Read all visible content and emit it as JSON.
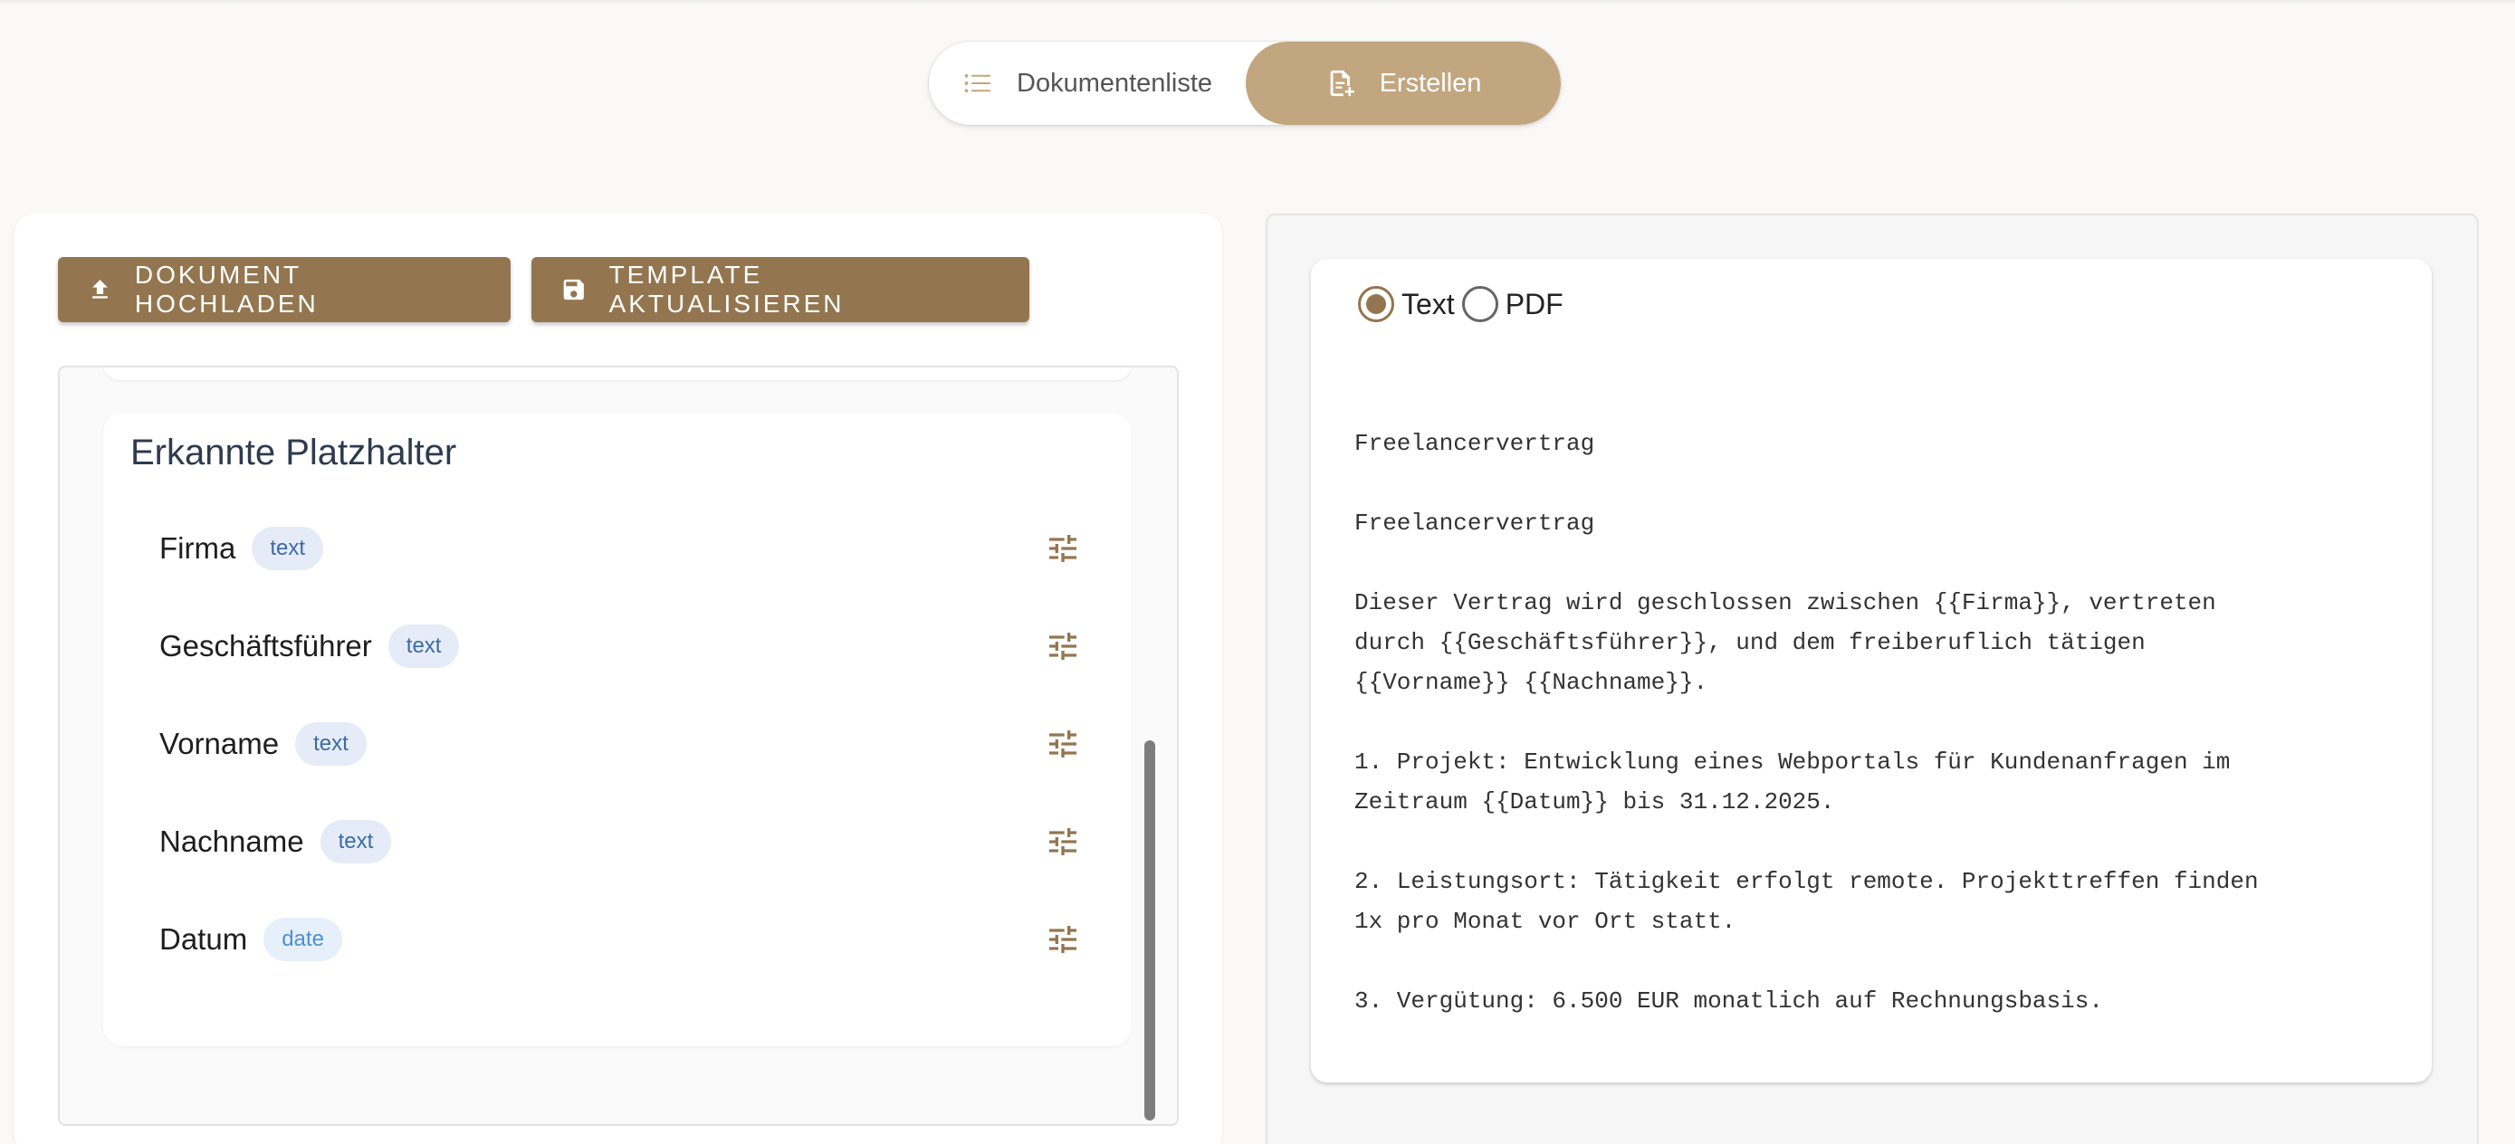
{
  "nav": {
    "tabs": [
      {
        "label": "Dokumentenliste",
        "icon": "list-icon",
        "active": false
      },
      {
        "label": "Erstellen",
        "icon": "file-add-icon",
        "active": true
      }
    ]
  },
  "toolbar": {
    "upload_label": "DOKUMENT HOCHLADEN",
    "update_label": "TEMPLATE AKTUALISIEREN"
  },
  "placeholders": {
    "title": "Erkannte Platzhalter",
    "items": [
      {
        "name": "Firma",
        "type": "text"
      },
      {
        "name": "Geschäftsführer",
        "type": "text"
      },
      {
        "name": "Vorname",
        "type": "text"
      },
      {
        "name": "Nachname",
        "type": "text"
      },
      {
        "name": "Datum",
        "type": "date"
      }
    ]
  },
  "preview": {
    "format_options": [
      {
        "label": "Text",
        "selected": true
      },
      {
        "label": "PDF",
        "selected": false
      }
    ],
    "text": "Freelancervertrag\n\nFreelancervertrag\n\nDieser Vertrag wird geschlossen zwischen {{Firma}}, vertreten\ndurch {{Geschäftsführer}}, und dem freiberuflich tätigen\n{{Vorname}} {{Nachname}}.\n\n1. Projekt: Entwicklung eines Webportals für Kundenanfragen im\nZeitraum {{Datum}} bis 31.12.2025.\n\n2. Leistungsort: Tätigkeit erfolgt remote. Projekttreffen finden\n1x pro Monat vor Ort statt.\n\n3. Vergütung: 6.500 EUR monatlich auf Rechnungsbasis."
  },
  "colors": {
    "accent": "#93764f",
    "accent_light": "#c2a67f",
    "chip_bg": "#e5ecf7",
    "chip_text": "#3d6aa5"
  }
}
